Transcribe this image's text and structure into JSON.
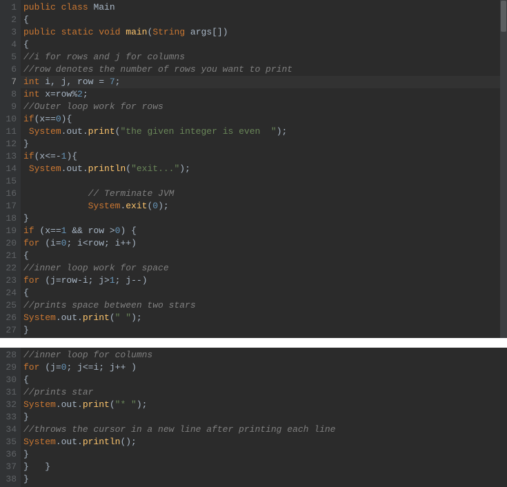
{
  "pane1": {
    "lines": [
      {
        "n": 1,
        "tokens": [
          [
            "kw",
            "public"
          ],
          [
            "op",
            " "
          ],
          [
            "kw",
            "class"
          ],
          [
            "op",
            " "
          ],
          [
            "cls",
            "Main"
          ]
        ]
      },
      {
        "n": 2,
        "tokens": [
          [
            "punct",
            "{"
          ]
        ]
      },
      {
        "n": 3,
        "tokens": [
          [
            "kw",
            "public"
          ],
          [
            "op",
            " "
          ],
          [
            "kw",
            "static"
          ],
          [
            "op",
            " "
          ],
          [
            "kw",
            "void"
          ],
          [
            "op",
            " "
          ],
          [
            "method",
            "main"
          ],
          [
            "punct",
            "("
          ],
          [
            "sys",
            "String"
          ],
          [
            "op",
            " args[]"
          ],
          [
            "punct",
            ")"
          ]
        ]
      },
      {
        "n": 4,
        "tokens": [
          [
            "punct",
            "{"
          ]
        ]
      },
      {
        "n": 5,
        "tokens": [
          [
            "comment",
            "//i for rows and j for columns"
          ]
        ]
      },
      {
        "n": 6,
        "tokens": [
          [
            "comment",
            "//row denotes the number of rows you want to print"
          ]
        ]
      },
      {
        "n": 7,
        "active": true,
        "tokens": [
          [
            "kw",
            "int"
          ],
          [
            "op",
            " i, j, row = "
          ],
          [
            "num",
            "7"
          ],
          [
            "punct",
            ";"
          ]
        ]
      },
      {
        "n": 8,
        "tokens": [
          [
            "kw",
            "int"
          ],
          [
            "op",
            " x=row"
          ],
          [
            "op",
            "%"
          ],
          [
            "num",
            "2"
          ],
          [
            "punct",
            ";"
          ]
        ]
      },
      {
        "n": 9,
        "tokens": [
          [
            "comment",
            "//Outer loop work for rows"
          ]
        ]
      },
      {
        "n": 10,
        "tokens": [
          [
            "kw",
            "if"
          ],
          [
            "punct",
            "("
          ],
          [
            "op",
            "x=="
          ],
          [
            "num",
            "0"
          ],
          [
            "punct",
            "){"
          ]
        ]
      },
      {
        "n": 11,
        "tokens": [
          [
            "op",
            " "
          ],
          [
            "sys",
            "System"
          ],
          [
            "op",
            ".out."
          ],
          [
            "method",
            "print"
          ],
          [
            "punct",
            "("
          ],
          [
            "string",
            "\"the given integer is even  \""
          ],
          [
            "punct",
            ");"
          ]
        ]
      },
      {
        "n": 12,
        "tokens": [
          [
            "punct",
            "}"
          ]
        ]
      },
      {
        "n": 13,
        "tokens": [
          [
            "kw",
            "if"
          ],
          [
            "punct",
            "("
          ],
          [
            "op",
            "x<="
          ],
          [
            "op",
            "-"
          ],
          [
            "num",
            "1"
          ],
          [
            "punct",
            "){"
          ]
        ]
      },
      {
        "n": 14,
        "tokens": [
          [
            "op",
            " "
          ],
          [
            "sys",
            "System"
          ],
          [
            "op",
            ".out."
          ],
          [
            "method",
            "println"
          ],
          [
            "punct",
            "("
          ],
          [
            "string",
            "\"exit...\""
          ],
          [
            "punct",
            ");"
          ]
        ]
      },
      {
        "n": 15,
        "tokens": [
          [
            "op",
            " "
          ]
        ]
      },
      {
        "n": 16,
        "tokens": [
          [
            "op",
            "            "
          ],
          [
            "comment",
            "// Terminate JVM"
          ]
        ]
      },
      {
        "n": 17,
        "tokens": [
          [
            "op",
            "            "
          ],
          [
            "sys",
            "System"
          ],
          [
            "op",
            "."
          ],
          [
            "method",
            "exit"
          ],
          [
            "punct",
            "("
          ],
          [
            "num",
            "0"
          ],
          [
            "punct",
            ");"
          ]
        ]
      },
      {
        "n": 18,
        "tokens": [
          [
            "punct",
            "}"
          ]
        ]
      },
      {
        "n": 19,
        "tokens": [
          [
            "kw",
            "if"
          ],
          [
            "op",
            " "
          ],
          [
            "punct",
            "("
          ],
          [
            "op",
            "x=="
          ],
          [
            "num",
            "1"
          ],
          [
            "op",
            " && row >"
          ],
          [
            "num",
            "0"
          ],
          [
            "punct",
            ") {"
          ]
        ]
      },
      {
        "n": 20,
        "tokens": [
          [
            "kw",
            "for"
          ],
          [
            "op",
            " "
          ],
          [
            "punct",
            "("
          ],
          [
            "op",
            "i="
          ],
          [
            "num",
            "0"
          ],
          [
            "op",
            "; i<row; i++"
          ],
          [
            "punct",
            ")"
          ]
        ]
      },
      {
        "n": 21,
        "tokens": [
          [
            "punct",
            "{"
          ]
        ]
      },
      {
        "n": 22,
        "tokens": [
          [
            "comment",
            "//inner loop work for space"
          ]
        ]
      },
      {
        "n": 23,
        "tokens": [
          [
            "kw",
            "for"
          ],
          [
            "op",
            " "
          ],
          [
            "punct",
            "("
          ],
          [
            "op",
            "j=row-i; j>"
          ],
          [
            "num",
            "1"
          ],
          [
            "op",
            "; j--"
          ],
          [
            "punct",
            ")"
          ]
        ]
      },
      {
        "n": 24,
        "tokens": [
          [
            "punct",
            "{"
          ]
        ]
      },
      {
        "n": 25,
        "tokens": [
          [
            "comment",
            "//prints space between two stars"
          ]
        ]
      },
      {
        "n": 26,
        "tokens": [
          [
            "sys",
            "System"
          ],
          [
            "op",
            ".out."
          ],
          [
            "method",
            "print"
          ],
          [
            "punct",
            "("
          ],
          [
            "string",
            "\" \""
          ],
          [
            "punct",
            ");"
          ]
        ]
      },
      {
        "n": 27,
        "tokens": [
          [
            "punct",
            "}"
          ]
        ]
      }
    ]
  },
  "pane2": {
    "lines": [
      {
        "n": 28,
        "tokens": [
          [
            "comment",
            "//inner loop for columns"
          ]
        ]
      },
      {
        "n": 29,
        "tokens": [
          [
            "kw",
            "for"
          ],
          [
            "op",
            " "
          ],
          [
            "punct",
            "("
          ],
          [
            "op",
            "j="
          ],
          [
            "num",
            "0"
          ],
          [
            "op",
            "; j<=i; j++ "
          ],
          [
            "punct",
            ")"
          ]
        ]
      },
      {
        "n": 30,
        "tokens": [
          [
            "punct",
            "{"
          ]
        ]
      },
      {
        "n": 31,
        "tokens": [
          [
            "comment",
            "//prints star"
          ]
        ]
      },
      {
        "n": 32,
        "tokens": [
          [
            "sys",
            "System"
          ],
          [
            "op",
            ".out."
          ],
          [
            "method",
            "print"
          ],
          [
            "punct",
            "("
          ],
          [
            "string",
            "\"* \""
          ],
          [
            "punct",
            ");"
          ]
        ]
      },
      {
        "n": 33,
        "tokens": [
          [
            "punct",
            "}"
          ]
        ]
      },
      {
        "n": 34,
        "tokens": [
          [
            "comment",
            "//throws the cursor in a new line after printing each line"
          ]
        ]
      },
      {
        "n": 35,
        "tokens": [
          [
            "sys",
            "System"
          ],
          [
            "op",
            ".out."
          ],
          [
            "method",
            "println"
          ],
          [
            "punct",
            "();"
          ]
        ]
      },
      {
        "n": 36,
        "tokens": [
          [
            "punct",
            "}"
          ]
        ]
      },
      {
        "n": 37,
        "tokens": [
          [
            "punct",
            "}   }"
          ]
        ]
      },
      {
        "n": 38,
        "tokens": [
          [
            "punct",
            "}"
          ]
        ]
      }
    ]
  }
}
